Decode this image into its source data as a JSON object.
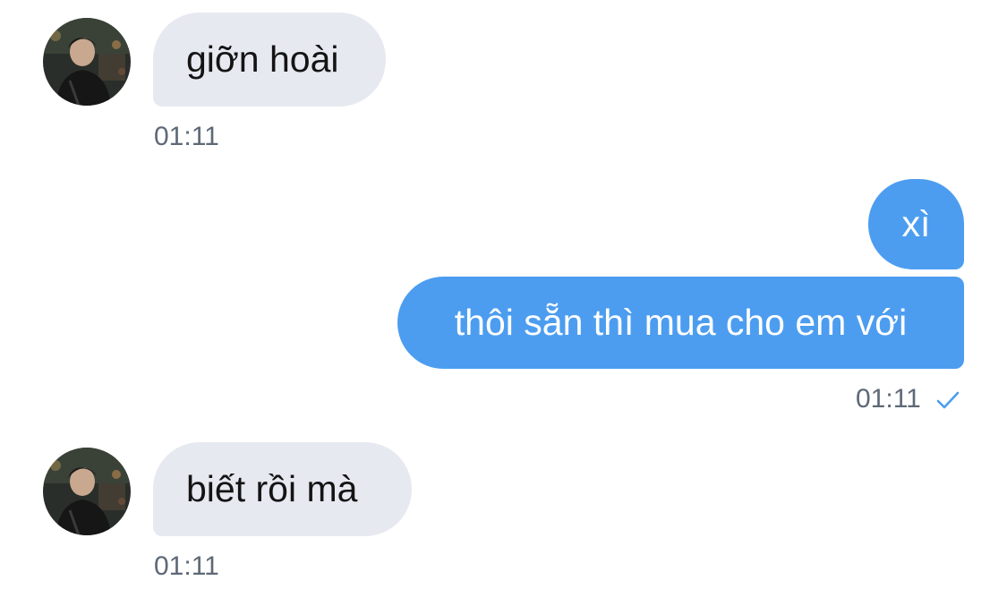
{
  "conversation": {
    "messages": [
      {
        "direction": "incoming",
        "text": "giỡn hoài",
        "time": "01:11"
      },
      {
        "direction": "outgoing",
        "text": "xì"
      },
      {
        "direction": "outgoing",
        "text": "thôi sẵn thì mua cho em với",
        "time": "01:11",
        "status": "sent"
      },
      {
        "direction": "incoming",
        "text": "biết rồi mà",
        "time": "01:11"
      }
    ]
  },
  "icons": {
    "avatar": "contact-avatar-photo",
    "status": "checkmark-icon"
  },
  "colors": {
    "incoming_bubble": "#e6e9f0",
    "outgoing_bubble": "#4c9df0",
    "timestamp": "#5e6976",
    "checkmark": "#4c9df0"
  }
}
